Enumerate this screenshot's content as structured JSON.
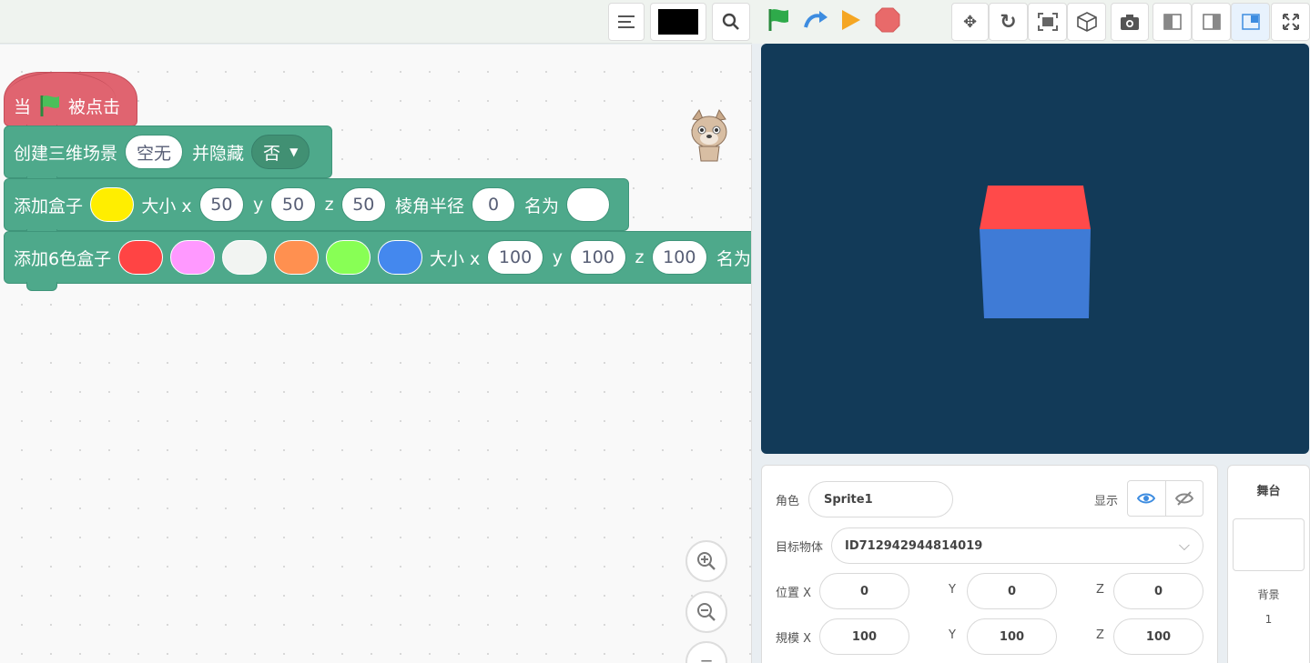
{
  "toolbar": {
    "align_icon": "align-icon",
    "color_swatch": "#000000",
    "search_icon": "search-icon"
  },
  "run_controls": {
    "green_flag": "#2eaa4a",
    "step": "#3d8ce0",
    "play": "#f5a623",
    "stop": "#e86a6a"
  },
  "view_controls": [
    "move-icon",
    "redo-icon",
    "fit-icon",
    "cube-icon",
    "camera-icon",
    "layout-left-icon",
    "layout-right-icon",
    "layout-small-stage-icon",
    "fullscreen-icon"
  ],
  "blocks": {
    "hat": {
      "when": "当",
      "clicked": "被点击"
    },
    "create_scene": {
      "label": "创建三维场景",
      "name_value": "空无",
      "hide_label": "并隐藏",
      "hide_value": "否"
    },
    "add_box": {
      "label": "添加盒子",
      "color": "#ffee00",
      "size_label": "大小 x",
      "x": "50",
      "y_label": "y",
      "y": "50",
      "z_label": "z",
      "z": "50",
      "radius_label": "棱角半径",
      "radius": "0",
      "name_label": "名为",
      "name_value": ""
    },
    "add_6color_box": {
      "label": "添加6色盒子",
      "colors": [
        "#ff4444",
        "#ff99ff",
        "#f2f4f2",
        "#ff9050",
        "#88ff55",
        "#4488ee"
      ],
      "size_label": "大小 x",
      "x": "100",
      "y_label": "y",
      "y": "100",
      "z_label": "z",
      "z": "100",
      "name_label": "名为"
    }
  },
  "stage": {
    "background": "#123a58",
    "cube_top": "#ff4a4a",
    "cube_front": "#3f7bd6"
  },
  "properties": {
    "sprite_label": "角色",
    "sprite_value": "Sprite1",
    "show_label": "显示",
    "target_label": "目标物体",
    "target_value": "ID712942944814019",
    "pos_label": "位置 X",
    "pos_x": "0",
    "pos_y_label": "Y",
    "pos_y": "0",
    "pos_z_label": "Z",
    "pos_z": "0",
    "scale_label": "規模 X",
    "scale_x": "100",
    "scale_y_label": "Y",
    "scale_y": "100",
    "scale_z_label": "Z",
    "scale_z": "100"
  },
  "stage_panel": {
    "title": "舞台",
    "backdrop_label": "背景",
    "backdrop_count": "1"
  }
}
